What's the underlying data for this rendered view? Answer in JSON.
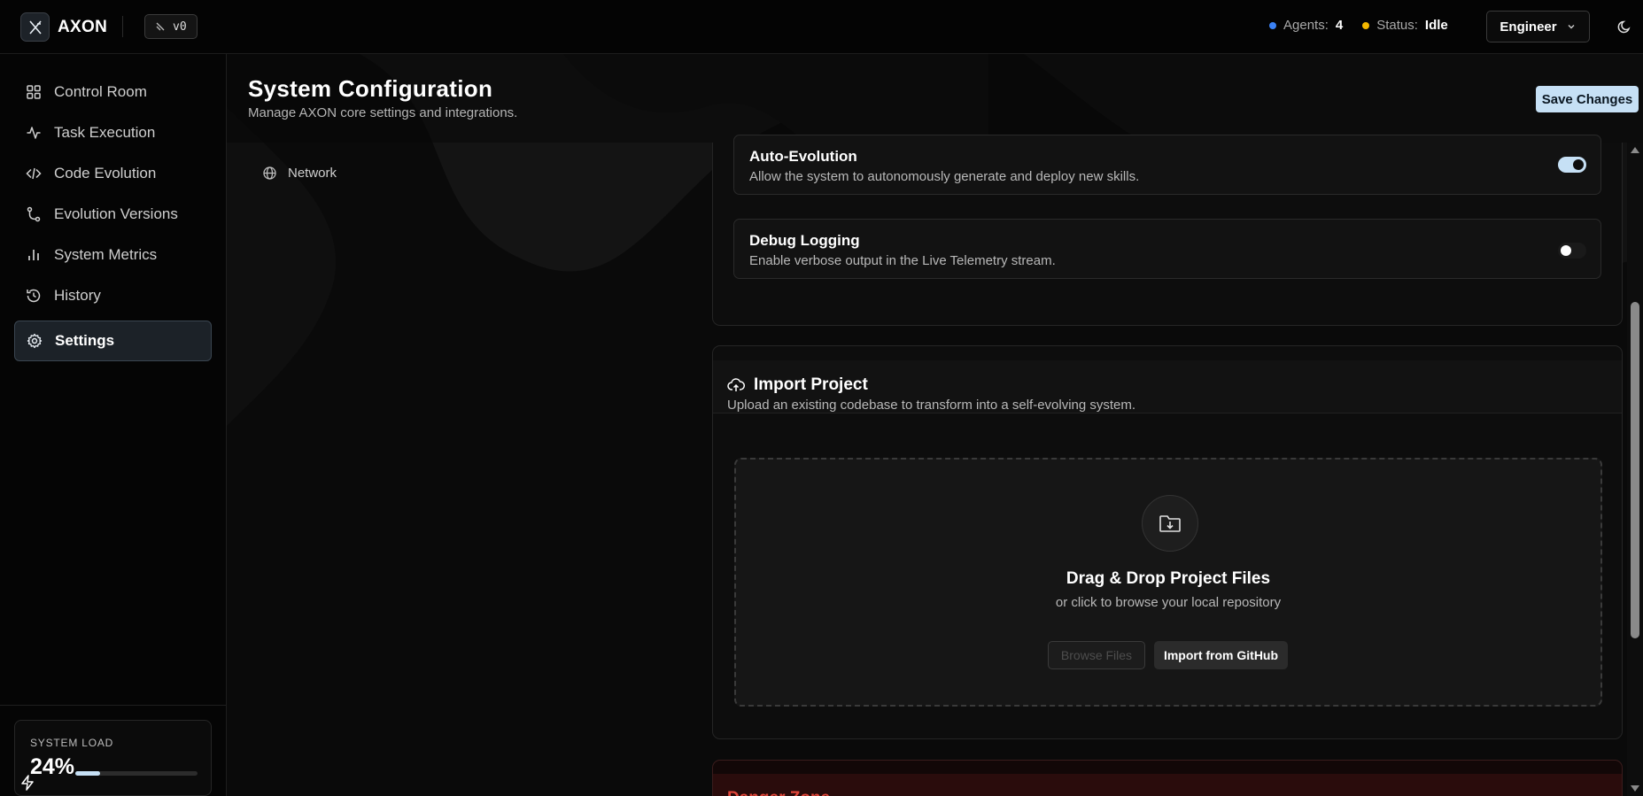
{
  "app": {
    "name": "AXON",
    "version": "v0"
  },
  "header": {
    "agents_label": "Agents:",
    "agents_value": "4",
    "status_label": "Status:",
    "status_value": "Idle",
    "role": "Engineer",
    "agents_dot_color": "#3b82f6",
    "status_dot_color": "#f5b800"
  },
  "sidebar": {
    "items": [
      {
        "label": "Control Room",
        "icon": "layout-grid-icon"
      },
      {
        "label": "Task Execution",
        "icon": "activity-icon"
      },
      {
        "label": "Code Evolution",
        "icon": "code-icon"
      },
      {
        "label": "Evolution Versions",
        "icon": "git-branch-icon"
      },
      {
        "label": "System Metrics",
        "icon": "bar-chart-icon"
      },
      {
        "label": "History",
        "icon": "history-icon"
      },
      {
        "label": "Settings",
        "icon": "gear-icon",
        "active": true
      }
    ],
    "system_load": {
      "label": "SYSTEM LOAD",
      "value_text": "24%",
      "fraction": 0.2
    }
  },
  "page": {
    "title": "System Configuration",
    "subtitle": "Manage AXON core settings and integrations.",
    "save_label": "Save Changes",
    "subnav": {
      "label": "Network",
      "icon": "globe-icon"
    }
  },
  "settings": {
    "auto_evolution": {
      "title": "Auto-Evolution",
      "description": "Allow the system to autonomously generate and deploy new skills.",
      "enabled": true
    },
    "debug_logging": {
      "title": "Debug Logging",
      "description": "Enable verbose output in the Live Telemetry stream.",
      "enabled": false
    }
  },
  "import_project": {
    "title": "Import Project",
    "description": "Upload an existing codebase to transform into a self-evolving system.",
    "drop_title": "Drag & Drop Project Files",
    "drop_sub": "or click to browse your local repository",
    "browse_label": "Browse Files",
    "github_label": "Import from GitHub"
  },
  "danger_zone": {
    "title": "Danger Zone"
  },
  "colors": {
    "accent": "#c6e0f5",
    "danger": "#e0463a"
  }
}
